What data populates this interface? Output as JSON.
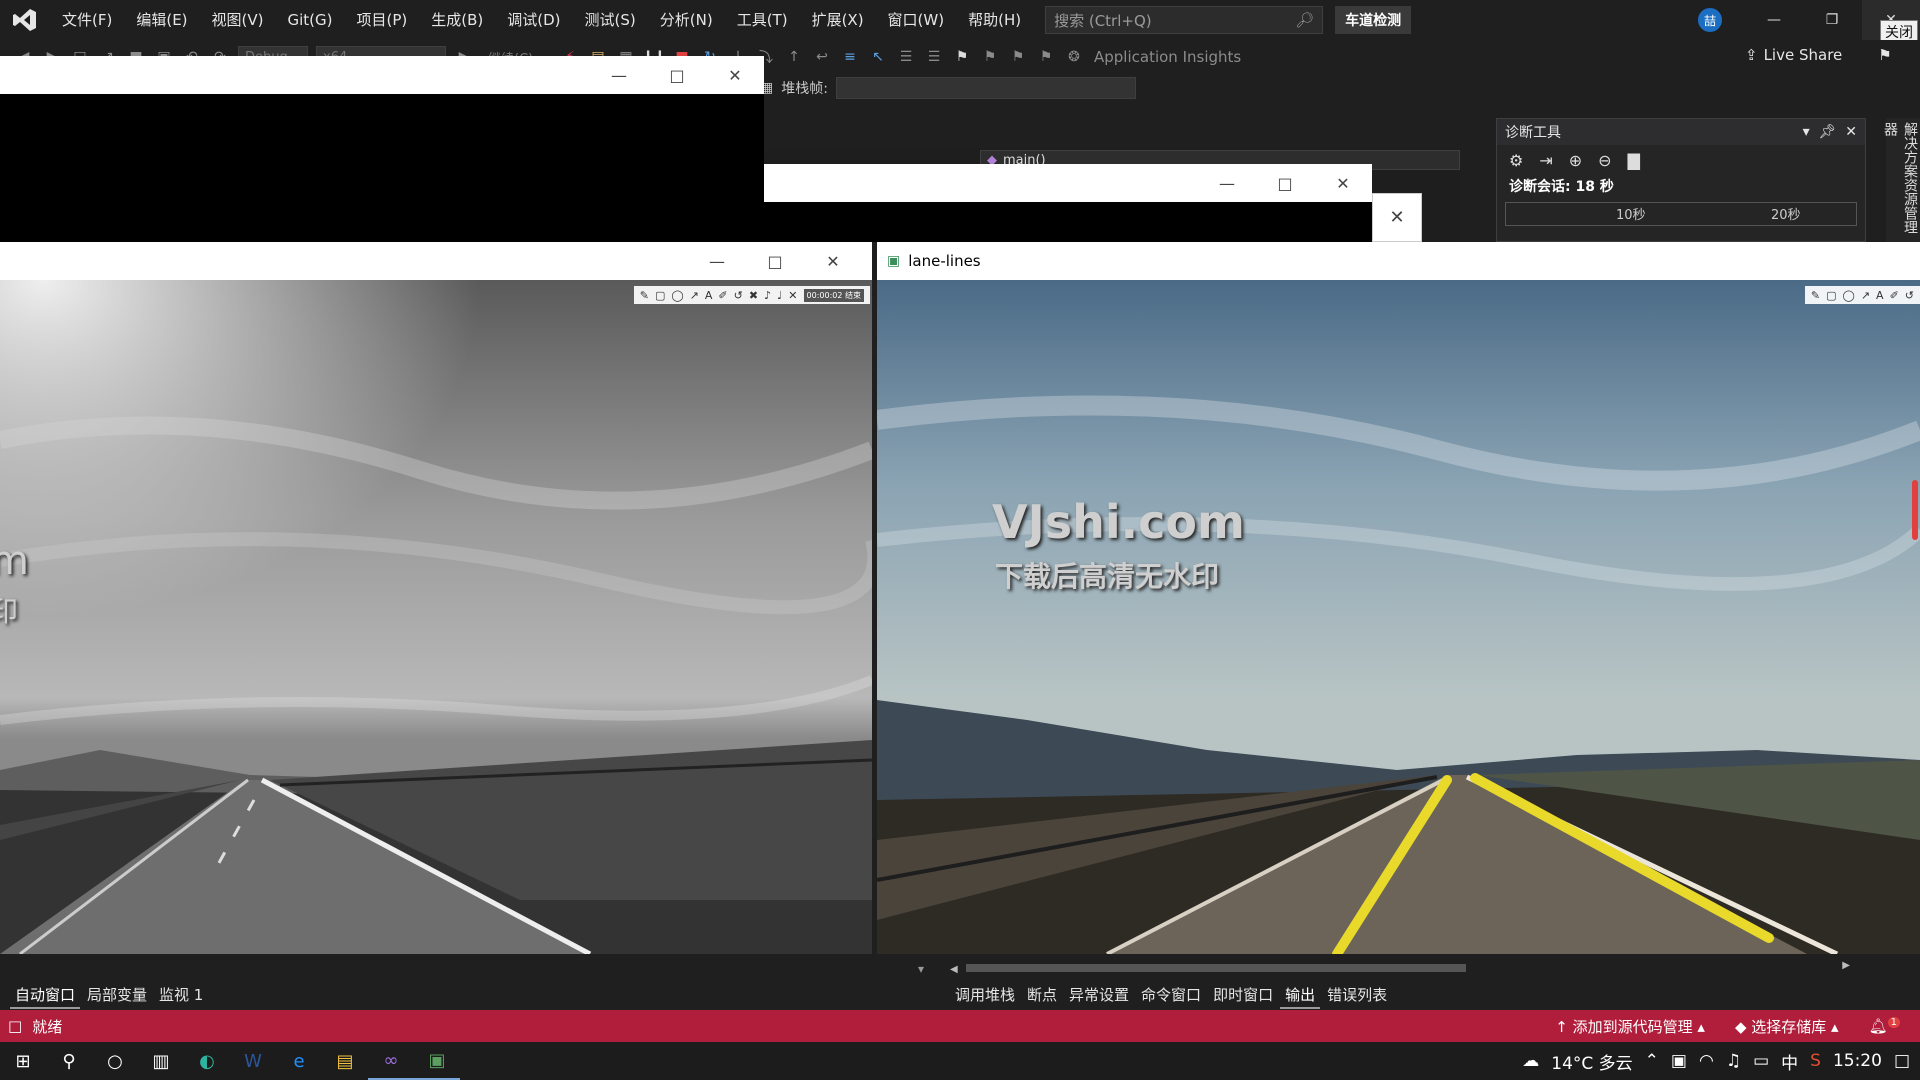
{
  "menu": {
    "items": [
      "文件(F)",
      "编辑(E)",
      "视图(V)",
      "Git(G)",
      "项目(P)",
      "生成(B)",
      "调试(D)",
      "测试(S)",
      "分析(N)",
      "工具(T)",
      "扩展(X)",
      "窗口(W)",
      "帮助(H)"
    ],
    "search_placeholder": "搜索 (Ctrl+Q)",
    "solution_name": "车道检测",
    "avatar_initial": "喆",
    "close_tooltip": "关闭"
  },
  "toolbar": {
    "config_combo": "Debug",
    "platform_combo": "x64",
    "continue_label": "继续(C)",
    "app_insights": "Application Insights",
    "live_share": "Live Share",
    "stackframe_label": "堆栈帧:"
  },
  "editor": {
    "nav_function": "main()"
  },
  "diagnostics": {
    "title": "诊断工具",
    "session": "诊断会话: 18 秒",
    "ruler_labels": [
      "10秒",
      "20秒"
    ],
    "side_tab": "解决方案资源管理器"
  },
  "windows": {
    "lane_title": "lane-lines",
    "gray_time_chip": "00:00:02 结束",
    "watermark_main": "VJshi.com",
    "watermark_sub": "下载后高清无水印"
  },
  "bottom": {
    "left_tabs": [
      "自动窗口",
      "局部变量",
      "监视 1"
    ],
    "right_tabs": [
      "调用堆栈",
      "断点",
      "异常设置",
      "命令窗口",
      "即时窗口",
      "输出",
      "错误列表"
    ],
    "active_right_tab": "输出"
  },
  "status": {
    "ready": "就绪",
    "source_control": "添加到源代码管理",
    "select_repo": "选择存储库",
    "notification_count": "1",
    "bar_color": "#b01e3c"
  },
  "taskbar": {
    "weather": "14°C 多云",
    "ime": "中",
    "time": "15:20"
  }
}
